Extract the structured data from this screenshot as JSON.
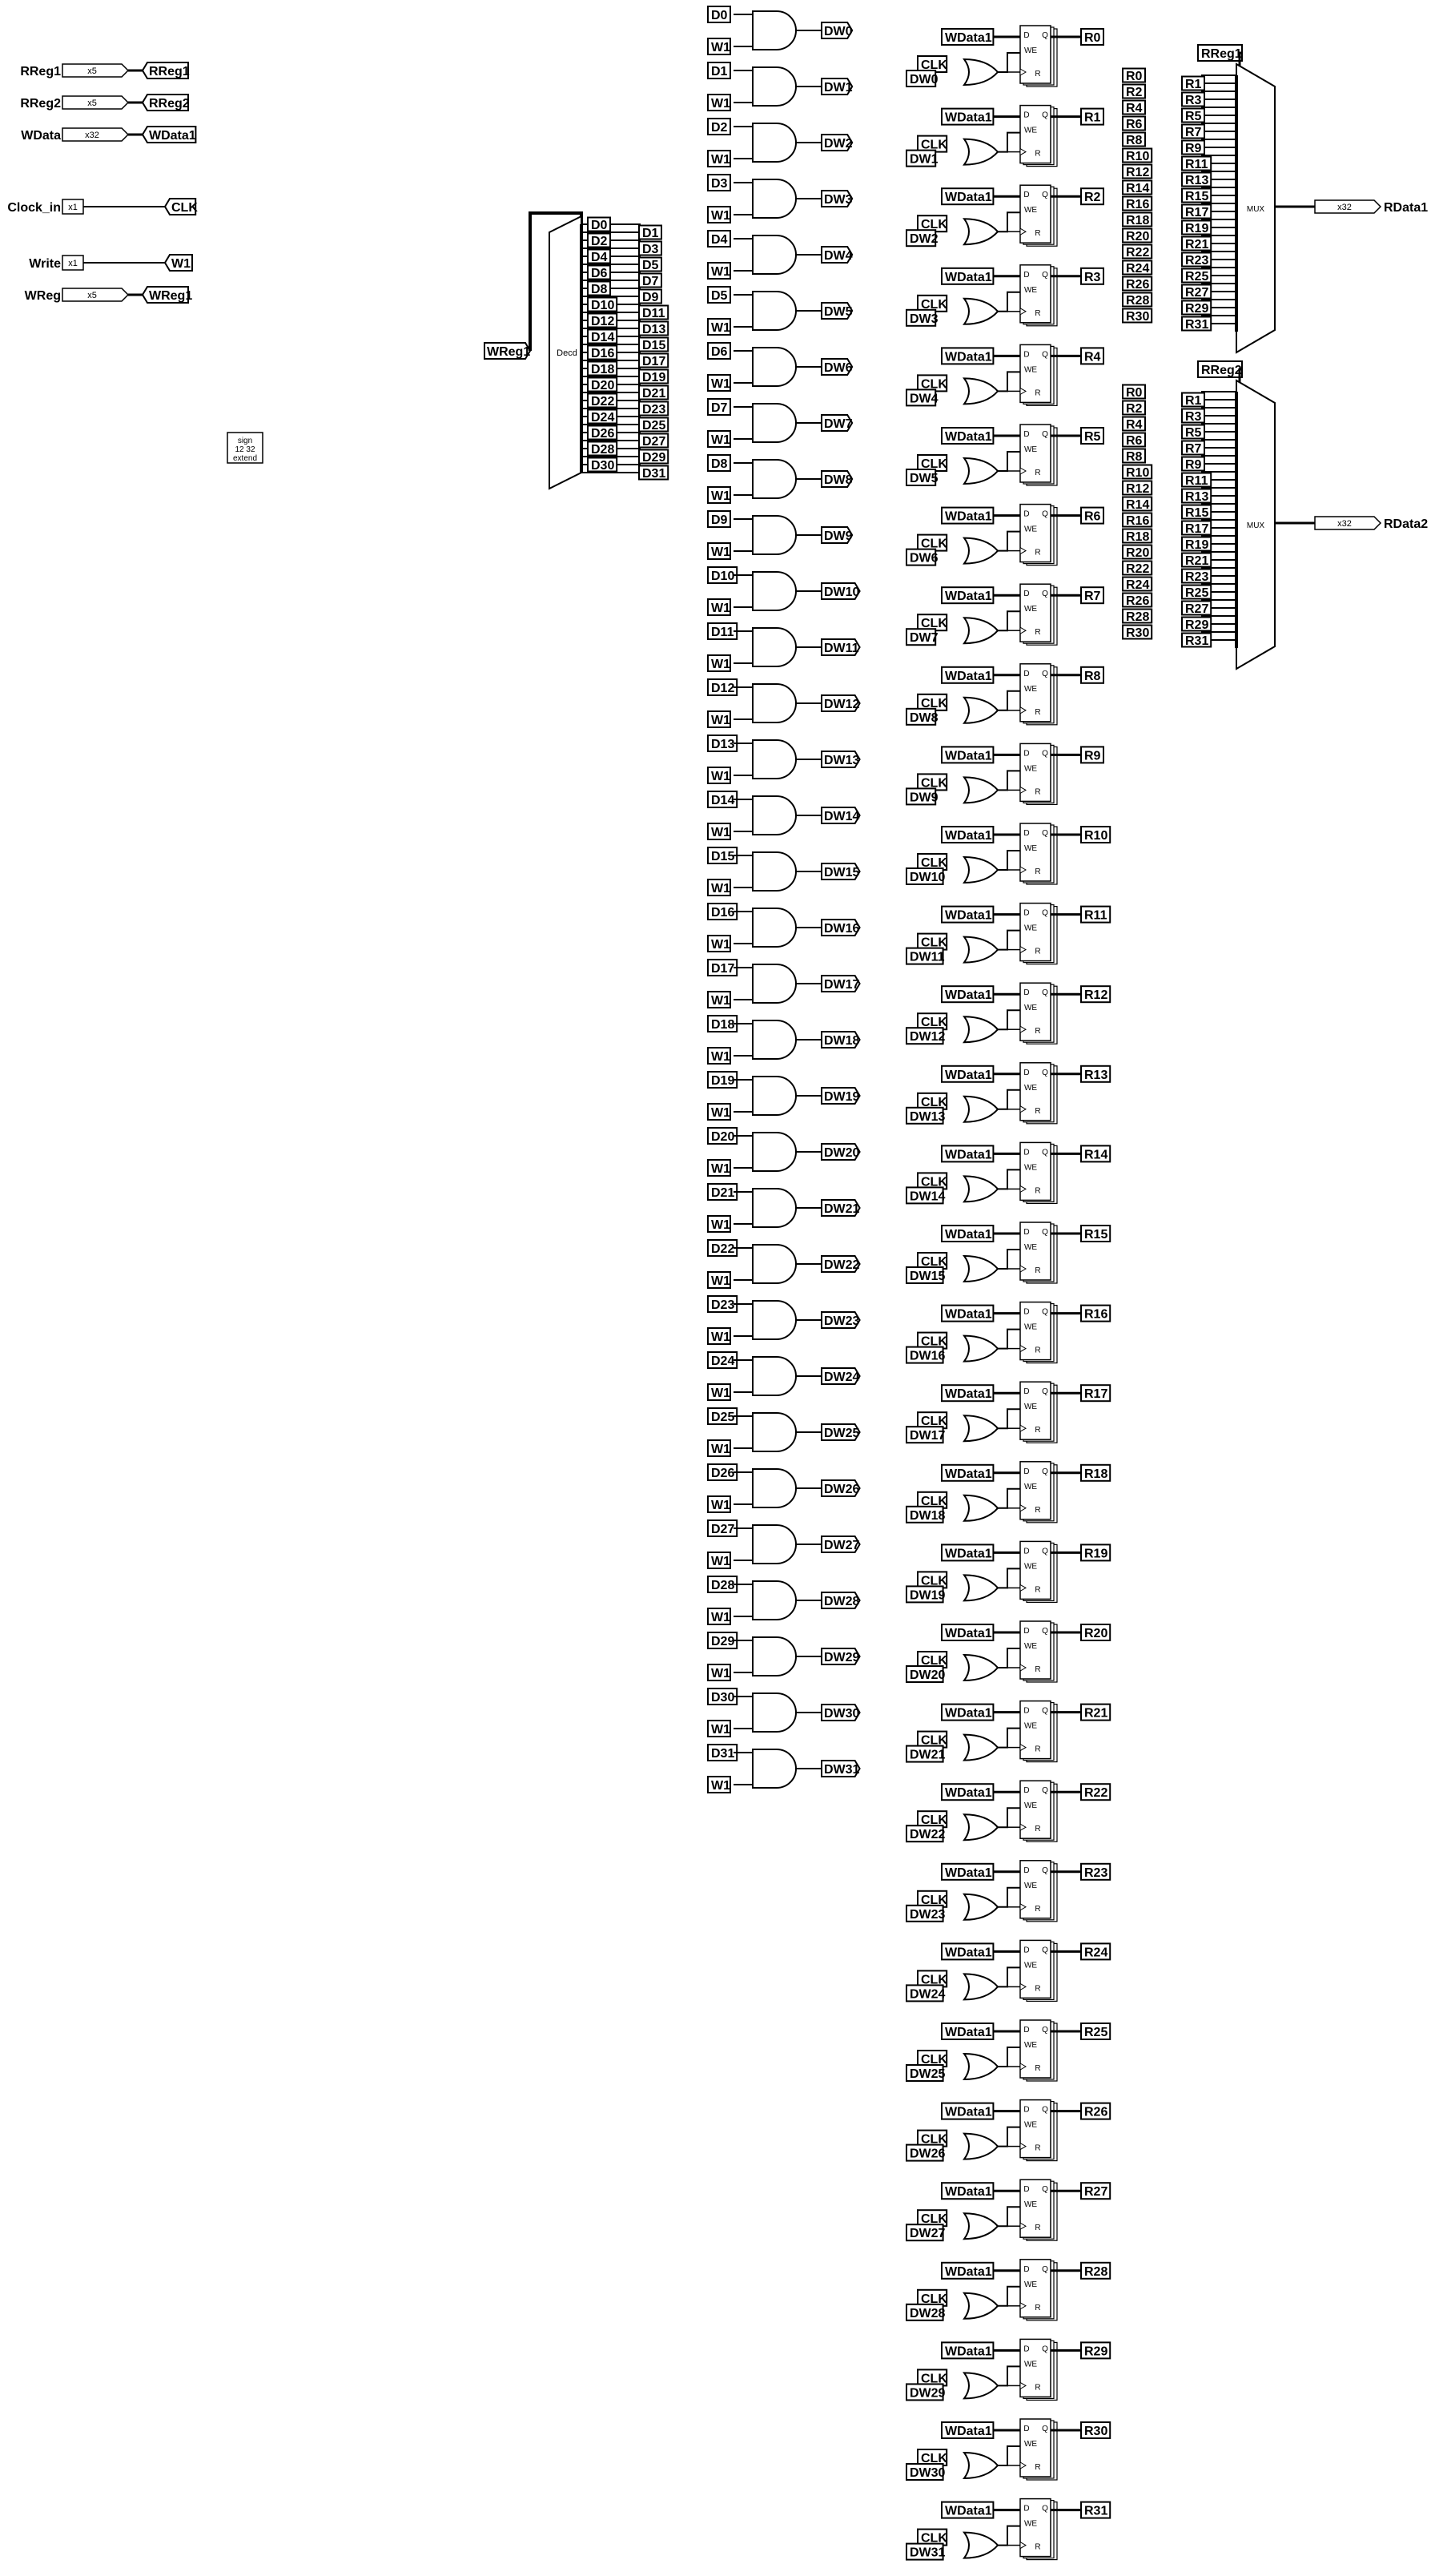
{
  "inputs": [
    {
      "name": "RReg1",
      "width": "x5",
      "tunnel": "RReg1"
    },
    {
      "name": "RReg2",
      "width": "x5",
      "tunnel": "RReg2"
    },
    {
      "name": "WData",
      "width": "x32",
      "tunnel": "WData1"
    },
    {
      "name": "Clock_in",
      "width": "x1",
      "tunnel": "CLK"
    },
    {
      "name": "Write",
      "width": "x1",
      "tunnel": "W1"
    },
    {
      "name": "WReg",
      "width": "x5",
      "tunnel": "WReg1"
    }
  ],
  "sign_extend": {
    "line1": "sign",
    "line2": "12 32",
    "line3": "extend"
  },
  "decoder": {
    "label": "Decd",
    "input": "WReg1"
  },
  "and_stage": {
    "enable": "W1"
  },
  "registers": {
    "data": "WData1",
    "clock": "CLK",
    "pin_d": "D",
    "pin_q": "Q",
    "pin_we": "WE",
    "pin_r": "R"
  },
  "muxes": [
    {
      "label": "MUX",
      "select": "RReg1",
      "width": "x32",
      "output": "RData1"
    },
    {
      "label": "MUX",
      "select": "RReg2",
      "width": "x32",
      "output": "RData2"
    }
  ]
}
